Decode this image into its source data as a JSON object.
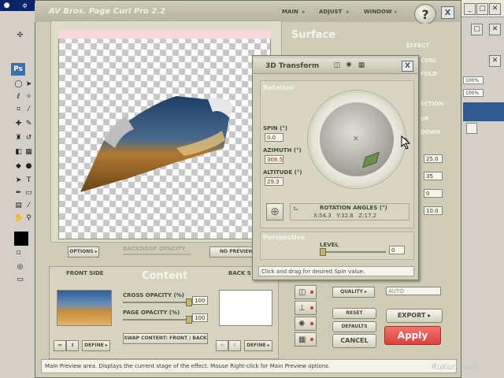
{
  "photoshop": {
    "title_fragment": "Ps",
    "file_fragment": "ф",
    "right_zoom_1": "100%",
    "right_zoom_2": "100%"
  },
  "plugin": {
    "title": "AV Bros. Page Curl Pro 2.2",
    "menu": {
      "main": "MAIN",
      "adjust": "ADJUST",
      "window": "WINDOW"
    },
    "help_label": "?",
    "close_label": "X",
    "options_button": "OPTIONS",
    "backdrop_opacity_label": "BACKDROP OPACITY",
    "no_preview_button": "NO PREVIEW",
    "surface_title": "Surface",
    "effect_label": "EFFECT",
    "curl_label": "CURL",
    "fold_label": "FOLD",
    "direction_label": "ECTION",
    "up_label": "UP",
    "down_label": "DOWN",
    "right_values": [
      "25.0",
      "35",
      "0",
      "10.0"
    ],
    "content_title": "Content",
    "front_side_label": "FRONT SIDE",
    "back_side_label": "BACK S",
    "cross_opacity_label": "CROSS OPACITY (%)",
    "cross_opacity_value": "100",
    "page_opacity_label": "PAGE OPACITY (%)",
    "page_opacity_value": "100",
    "swap_button": "SWAP CONTENT: FRONT / BACK",
    "define_front_button": "DEFINE",
    "define_back_button": "DEFINE",
    "quality_label": "QUALITY",
    "quality_value": "AUTO",
    "reset_button": "RESET",
    "defaults_button": "DEFAULTS",
    "cancel_button": "CANCEL",
    "export_button": "EXPORT",
    "apply_button": "Apply",
    "status_text": "Main Preview area. Displays the current stage of the effect. Mouse Right-click for Main Preview options.",
    "watermark": "RuKurs.com"
  },
  "dialog": {
    "title": "3D Transform",
    "close_label": "X",
    "rotation_label": "Rotation",
    "spin_label": "SPIN (°)",
    "spin_value": "0.0",
    "azimuth_label": "AZIMUTH (°)",
    "azimuth_value": "308.5",
    "altitude_label": "ALTITUDE (°)",
    "altitude_value": "29.3",
    "angles_label": "ROTATION ANGLES (°)",
    "angles_values": "X:54.3   Y:32.8   Z:17.2",
    "perspective_label": "Perspective",
    "level_label": "LEVEL",
    "level_value": "0",
    "hint": "Click and drag for desired Spin value."
  }
}
